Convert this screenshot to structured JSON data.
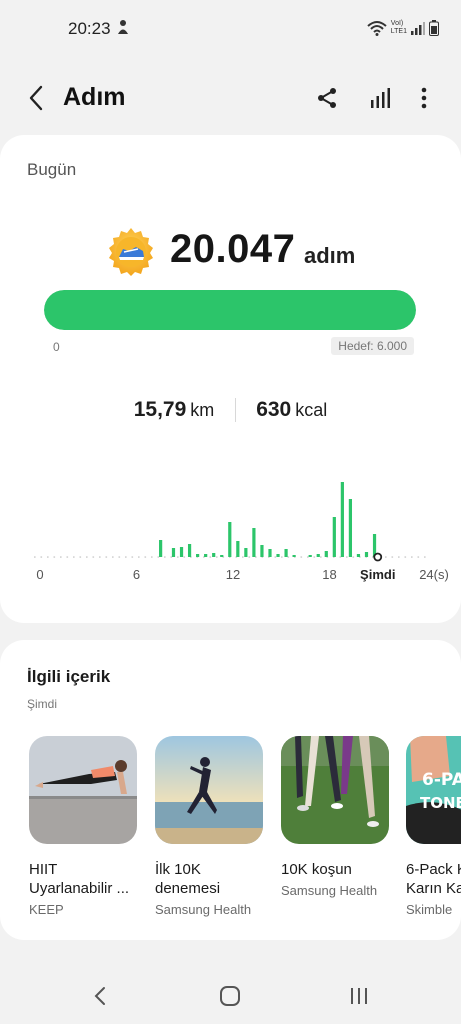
{
  "status_bar": {
    "time": "20:23",
    "network_line1": "VoI)",
    "network_line2": "LTE1"
  },
  "app_bar": {
    "title": "Adım"
  },
  "today": {
    "label": "Bugün",
    "steps": "20.047",
    "steps_unit": "adım",
    "progress_percent": 100,
    "progress_start": "0",
    "goal_label": "Hedef: 6.000",
    "distance_value": "15,79",
    "distance_unit": "km",
    "energy_value": "630",
    "energy_unit": "kcal",
    "accent_color": "#2cc56a"
  },
  "chart_data": {
    "type": "bar",
    "xlabel": "",
    "ylabel": "",
    "x_tick_labels": [
      "0",
      "6",
      "12",
      "18",
      "Şimdi",
      "24(s)"
    ],
    "x_range": [
      0,
      24
    ],
    "now_hour": 21,
    "y_range": [
      0,
      80
    ],
    "bars": [
      {
        "hour": 7.5,
        "value": 17
      },
      {
        "hour": 8.3,
        "value": 9
      },
      {
        "hour": 8.8,
        "value": 10
      },
      {
        "hour": 9.3,
        "value": 13
      },
      {
        "hour": 9.8,
        "value": 3
      },
      {
        "hour": 10.3,
        "value": 3
      },
      {
        "hour": 10.8,
        "value": 4
      },
      {
        "hour": 11.3,
        "value": 2
      },
      {
        "hour": 11.8,
        "value": 35
      },
      {
        "hour": 12.3,
        "value": 16
      },
      {
        "hour": 12.8,
        "value": 9
      },
      {
        "hour": 13.3,
        "value": 29
      },
      {
        "hour": 13.8,
        "value": 12
      },
      {
        "hour": 14.3,
        "value": 8
      },
      {
        "hour": 14.8,
        "value": 3
      },
      {
        "hour": 15.3,
        "value": 8
      },
      {
        "hour": 15.8,
        "value": 2
      },
      {
        "hour": 16.8,
        "value": 2
      },
      {
        "hour": 17.3,
        "value": 3
      },
      {
        "hour": 17.8,
        "value": 6
      },
      {
        "hour": 18.3,
        "value": 40
      },
      {
        "hour": 18.8,
        "value": 75
      },
      {
        "hour": 19.3,
        "value": 58
      },
      {
        "hour": 19.8,
        "value": 3
      },
      {
        "hour": 20.3,
        "value": 5
      },
      {
        "hour": 20.8,
        "value": 23
      }
    ],
    "bar_color": "#2cc56a"
  },
  "related": {
    "title": "İlgili içerik",
    "subtitle": "Şimdi",
    "items": [
      {
        "title": "HIIT\nUyarlanabilir ...",
        "source": "KEEP"
      },
      {
        "title": "İlk 10K\ndenemesi",
        "source": "Samsung Health"
      },
      {
        "title": "10K koşun",
        "source": "Samsung Health"
      },
      {
        "title": "6-Pack K\nKarın Ka",
        "source": "Skimble",
        "thumb_text_1": "6-PA",
        "thumb_text_2": "TONED"
      }
    ]
  },
  "icons": {
    "back": "back-arrow-icon",
    "share": "share-icon",
    "trends": "bar-chart-icon",
    "more": "more-vertical-icon",
    "medal": "running-shoe-medal-icon"
  }
}
